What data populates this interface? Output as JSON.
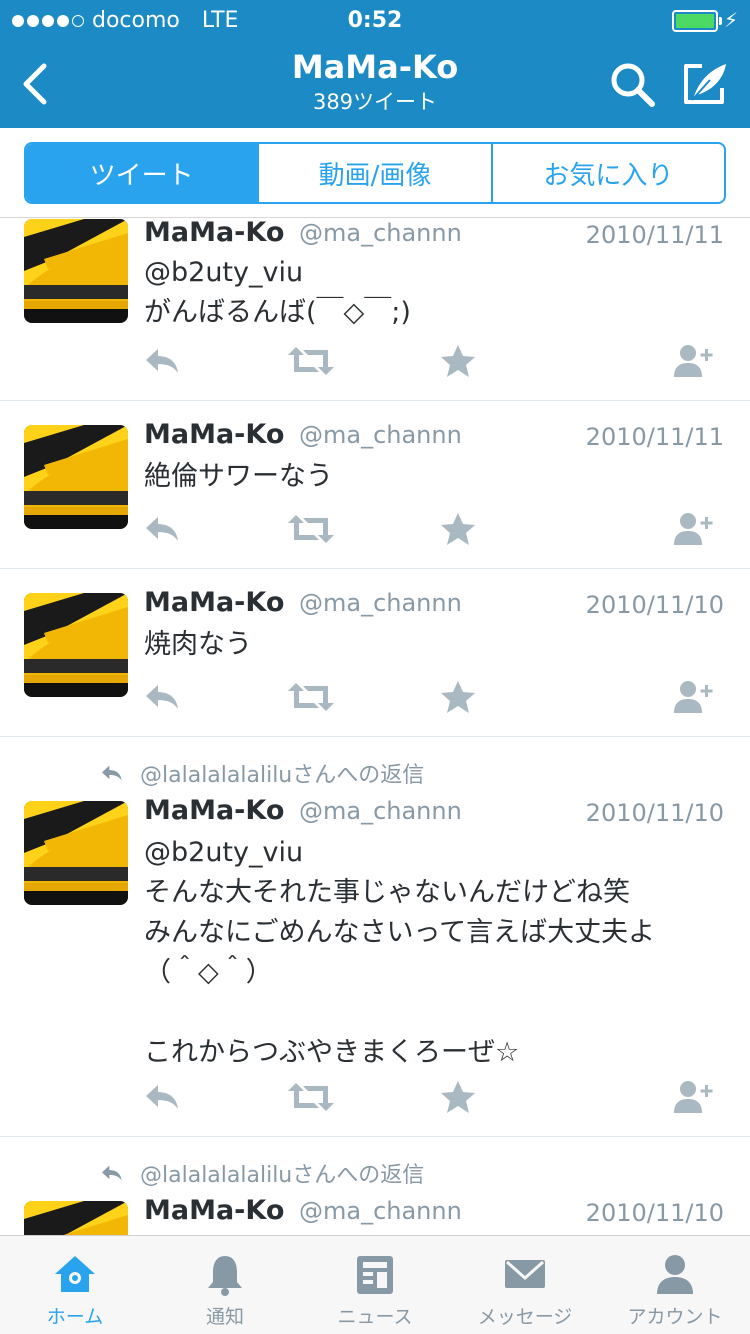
{
  "status_bar": {
    "carrier": "docomo",
    "network": "LTE",
    "time": "0:52"
  },
  "nav": {
    "title": "MaMa-Ko",
    "subtitle": "389ツイート"
  },
  "segments": [
    {
      "label": "ツイート",
      "active": true
    },
    {
      "label": "動画/画像",
      "active": false
    },
    {
      "label": "お気に入り",
      "active": false
    }
  ],
  "tweets": [
    {
      "name": "MaMa-Ko",
      "handle": "@ma_channn",
      "date": "2010/11/11",
      "lines": [
        "@b2uty_viu",
        "がんばるんば(￣◇￣;)"
      ]
    },
    {
      "name": "MaMa-Ko",
      "handle": "@ma_channn",
      "date": "2010/11/11",
      "lines": [
        "絶倫サワーなう"
      ]
    },
    {
      "name": "MaMa-Ko",
      "handle": "@ma_channn",
      "date": "2010/11/10",
      "lines": [
        "焼肉なう"
      ]
    },
    {
      "reply_to": "@lalalalalaliluさんへの返信",
      "name": "MaMa-Ko",
      "handle": "@ma_channn",
      "date": "2010/11/10",
      "lines": [
        "@b2uty_viu",
        "そんな大それた事じゃないんだけどね笑",
        "みんなにごめんなさいって言えば大丈夫よ",
        "（＾◇＾）",
        "",
        "これからつぶやきまくろーぜ☆"
      ]
    },
    {
      "reply_to": "@lalalalalaliluさんへの返信",
      "name": "MaMa-Ko",
      "handle": "@ma_channn",
      "date": "2010/11/10",
      "lines": []
    }
  ],
  "tabbar": [
    {
      "label": "ホーム",
      "icon": "home-icon",
      "active": true
    },
    {
      "label": "通知",
      "icon": "bell-icon",
      "active": false
    },
    {
      "label": "ニュース",
      "icon": "news-icon",
      "active": false
    },
    {
      "label": "メッセージ",
      "icon": "envelope-icon",
      "active": false
    },
    {
      "label": "アカウント",
      "icon": "person-icon",
      "active": false
    }
  ],
  "colors": {
    "nav_bg": "#1b8ac5",
    "accent": "#2aa3ef",
    "muted": "#8899a6",
    "action_icon": "#aab8c2"
  }
}
